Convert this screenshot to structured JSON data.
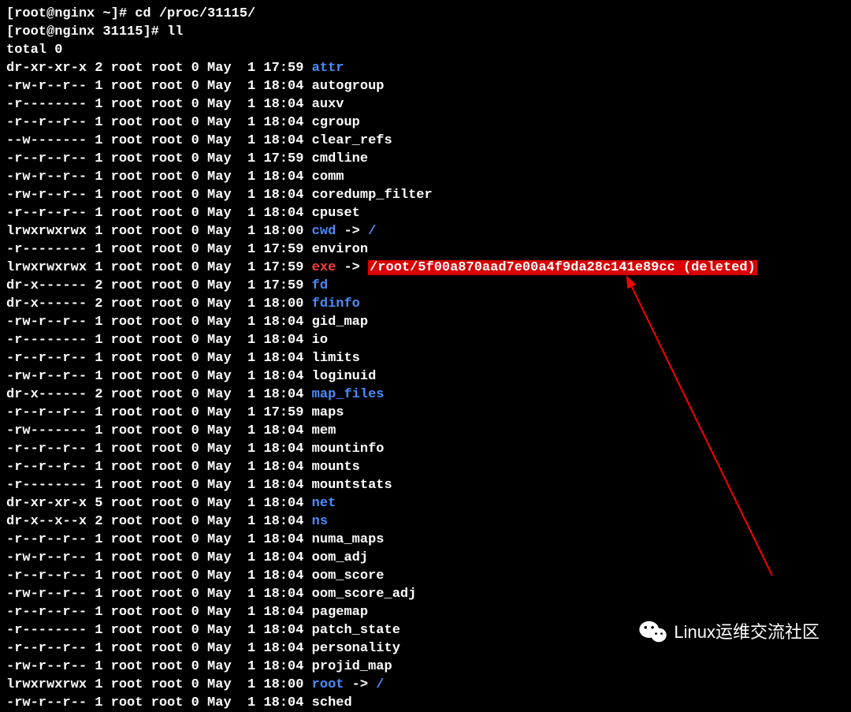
{
  "prompt1": {
    "open": "[",
    "userhost": "root@nginx ~",
    "close": "]# ",
    "cmd": "cd /proc/31115/"
  },
  "prompt2": {
    "open": "[",
    "userhost": "root@nginx 31115",
    "close": "]# ",
    "cmd": "ll"
  },
  "total": "total 0",
  "rows": [
    {
      "perm": "dr-xr-xr-x",
      "links": "2",
      "owner": "root",
      "group": "root",
      "size": "0",
      "mon": "May",
      "day": " 1",
      "time": "17:59",
      "name": "attr",
      "color": "blue"
    },
    {
      "perm": "-rw-r--r--",
      "links": "1",
      "owner": "root",
      "group": "root",
      "size": "0",
      "mon": "May",
      "day": " 1",
      "time": "18:04",
      "name": "autogroup",
      "color": "white"
    },
    {
      "perm": "-r--------",
      "links": "1",
      "owner": "root",
      "group": "root",
      "size": "0",
      "mon": "May",
      "day": " 1",
      "time": "18:04",
      "name": "auxv",
      "color": "white"
    },
    {
      "perm": "-r--r--r--",
      "links": "1",
      "owner": "root",
      "group": "root",
      "size": "0",
      "mon": "May",
      "day": " 1",
      "time": "18:04",
      "name": "cgroup",
      "color": "white"
    },
    {
      "perm": "--w-------",
      "links": "1",
      "owner": "root",
      "group": "root",
      "size": "0",
      "mon": "May",
      "day": " 1",
      "time": "18:04",
      "name": "clear_refs",
      "color": "white"
    },
    {
      "perm": "-r--r--r--",
      "links": "1",
      "owner": "root",
      "group": "root",
      "size": "0",
      "mon": "May",
      "day": " 1",
      "time": "17:59",
      "name": "cmdline",
      "color": "white"
    },
    {
      "perm": "-rw-r--r--",
      "links": "1",
      "owner": "root",
      "group": "root",
      "size": "0",
      "mon": "May",
      "day": " 1",
      "time": "18:04",
      "name": "comm",
      "color": "white"
    },
    {
      "perm": "-rw-r--r--",
      "links": "1",
      "owner": "root",
      "group": "root",
      "size": "0",
      "mon": "May",
      "day": " 1",
      "time": "18:04",
      "name": "coredump_filter",
      "color": "white"
    },
    {
      "perm": "-r--r--r--",
      "links": "1",
      "owner": "root",
      "group": "root",
      "size": "0",
      "mon": "May",
      "day": " 1",
      "time": "18:04",
      "name": "cpuset",
      "color": "white"
    },
    {
      "perm": "lrwxrwxrwx",
      "links": "1",
      "owner": "root",
      "group": "root",
      "size": "0",
      "mon": "May",
      "day": " 1",
      "time": "18:00",
      "name": "cwd",
      "color": "blue",
      "arrow": " -> ",
      "target": "/",
      "targetColor": "blue"
    },
    {
      "perm": "-r--------",
      "links": "1",
      "owner": "root",
      "group": "root",
      "size": "0",
      "mon": "May",
      "day": " 1",
      "time": "17:59",
      "name": "environ",
      "color": "white"
    },
    {
      "perm": "lrwxrwxrwx",
      "links": "1",
      "owner": "root",
      "group": "root",
      "size": "0",
      "mon": "May",
      "day": " 1",
      "time": "17:59",
      "name": "exe",
      "color": "red",
      "arrow": " -> ",
      "target": "/root/5f00a870aad7e00a4f9da28c141e89cc (deleted)",
      "targetHl": true
    },
    {
      "perm": "dr-x------",
      "links": "2",
      "owner": "root",
      "group": "root",
      "size": "0",
      "mon": "May",
      "day": " 1",
      "time": "17:59",
      "name": "fd",
      "color": "blue"
    },
    {
      "perm": "dr-x------",
      "links": "2",
      "owner": "root",
      "group": "root",
      "size": "0",
      "mon": "May",
      "day": " 1",
      "time": "18:00",
      "name": "fdinfo",
      "color": "blue"
    },
    {
      "perm": "-rw-r--r--",
      "links": "1",
      "owner": "root",
      "group": "root",
      "size": "0",
      "mon": "May",
      "day": " 1",
      "time": "18:04",
      "name": "gid_map",
      "color": "white"
    },
    {
      "perm": "-r--------",
      "links": "1",
      "owner": "root",
      "group": "root",
      "size": "0",
      "mon": "May",
      "day": " 1",
      "time": "18:04",
      "name": "io",
      "color": "white"
    },
    {
      "perm": "-r--r--r--",
      "links": "1",
      "owner": "root",
      "group": "root",
      "size": "0",
      "mon": "May",
      "day": " 1",
      "time": "18:04",
      "name": "limits",
      "color": "white"
    },
    {
      "perm": "-rw-r--r--",
      "links": "1",
      "owner": "root",
      "group": "root",
      "size": "0",
      "mon": "May",
      "day": " 1",
      "time": "18:04",
      "name": "loginuid",
      "color": "white"
    },
    {
      "perm": "dr-x------",
      "links": "2",
      "owner": "root",
      "group": "root",
      "size": "0",
      "mon": "May",
      "day": " 1",
      "time": "18:04",
      "name": "map_files",
      "color": "blue"
    },
    {
      "perm": "-r--r--r--",
      "links": "1",
      "owner": "root",
      "group": "root",
      "size": "0",
      "mon": "May",
      "day": " 1",
      "time": "17:59",
      "name": "maps",
      "color": "white"
    },
    {
      "perm": "-rw-------",
      "links": "1",
      "owner": "root",
      "group": "root",
      "size": "0",
      "mon": "May",
      "day": " 1",
      "time": "18:04",
      "name": "mem",
      "color": "white"
    },
    {
      "perm": "-r--r--r--",
      "links": "1",
      "owner": "root",
      "group": "root",
      "size": "0",
      "mon": "May",
      "day": " 1",
      "time": "18:04",
      "name": "mountinfo",
      "color": "white"
    },
    {
      "perm": "-r--r--r--",
      "links": "1",
      "owner": "root",
      "group": "root",
      "size": "0",
      "mon": "May",
      "day": " 1",
      "time": "18:04",
      "name": "mounts",
      "color": "white"
    },
    {
      "perm": "-r--------",
      "links": "1",
      "owner": "root",
      "group": "root",
      "size": "0",
      "mon": "May",
      "day": " 1",
      "time": "18:04",
      "name": "mountstats",
      "color": "white"
    },
    {
      "perm": "dr-xr-xr-x",
      "links": "5",
      "owner": "root",
      "group": "root",
      "size": "0",
      "mon": "May",
      "day": " 1",
      "time": "18:04",
      "name": "net",
      "color": "blue"
    },
    {
      "perm": "dr-x--x--x",
      "links": "2",
      "owner": "root",
      "group": "root",
      "size": "0",
      "mon": "May",
      "day": " 1",
      "time": "18:04",
      "name": "ns",
      "color": "blue"
    },
    {
      "perm": "-r--r--r--",
      "links": "1",
      "owner": "root",
      "group": "root",
      "size": "0",
      "mon": "May",
      "day": " 1",
      "time": "18:04",
      "name": "numa_maps",
      "color": "white"
    },
    {
      "perm": "-rw-r--r--",
      "links": "1",
      "owner": "root",
      "group": "root",
      "size": "0",
      "mon": "May",
      "day": " 1",
      "time": "18:04",
      "name": "oom_adj",
      "color": "white"
    },
    {
      "perm": "-r--r--r--",
      "links": "1",
      "owner": "root",
      "group": "root",
      "size": "0",
      "mon": "May",
      "day": " 1",
      "time": "18:04",
      "name": "oom_score",
      "color": "white"
    },
    {
      "perm": "-rw-r--r--",
      "links": "1",
      "owner": "root",
      "group": "root",
      "size": "0",
      "mon": "May",
      "day": " 1",
      "time": "18:04",
      "name": "oom_score_adj",
      "color": "white"
    },
    {
      "perm": "-r--r--r--",
      "links": "1",
      "owner": "root",
      "group": "root",
      "size": "0",
      "mon": "May",
      "day": " 1",
      "time": "18:04",
      "name": "pagemap",
      "color": "white"
    },
    {
      "perm": "-r--------",
      "links": "1",
      "owner": "root",
      "group": "root",
      "size": "0",
      "mon": "May",
      "day": " 1",
      "time": "18:04",
      "name": "patch_state",
      "color": "white"
    },
    {
      "perm": "-r--r--r--",
      "links": "1",
      "owner": "root",
      "group": "root",
      "size": "0",
      "mon": "May",
      "day": " 1",
      "time": "18:04",
      "name": "personality",
      "color": "white"
    },
    {
      "perm": "-rw-r--r--",
      "links": "1",
      "owner": "root",
      "group": "root",
      "size": "0",
      "mon": "May",
      "day": " 1",
      "time": "18:04",
      "name": "projid_map",
      "color": "white"
    },
    {
      "perm": "lrwxrwxrwx",
      "links": "1",
      "owner": "root",
      "group": "root",
      "size": "0",
      "mon": "May",
      "day": " 1",
      "time": "18:00",
      "name": "root",
      "color": "blue",
      "arrow": " -> ",
      "target": "/",
      "targetColor": "blue"
    },
    {
      "perm": "-rw-r--r--",
      "links": "1",
      "owner": "root",
      "group": "root",
      "size": "0",
      "mon": "May",
      "day": " 1",
      "time": "18:04",
      "name": "sched",
      "color": "white"
    }
  ],
  "watermark": "Linux运维交流社区"
}
